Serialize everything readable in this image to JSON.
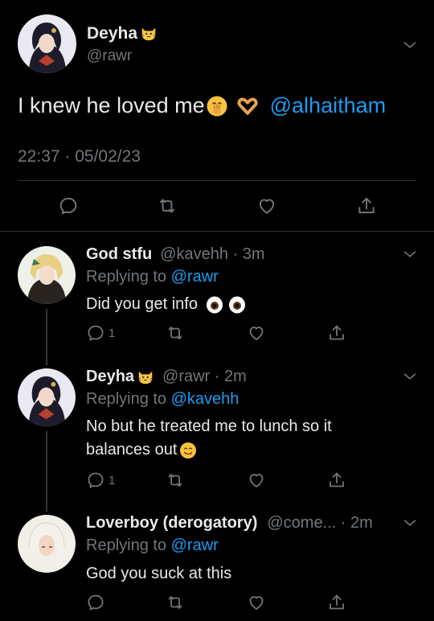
{
  "main": {
    "name": "Deyha",
    "handle": "@rawr",
    "text": "I knew he loved me",
    "mention": "@alhaitham",
    "timestamp": "22:37 · 05/02/23"
  },
  "replies": [
    {
      "name": "God stfu",
      "meta": "@kavehh · 3m",
      "replying_prefix": "Replying to ",
      "replying_to": "@rawr",
      "text": "Did you get info",
      "reply_count": "1"
    },
    {
      "name": "Deyha",
      "meta": "@rawr · 2m",
      "replying_prefix": "Replying to ",
      "replying_to": "@kavehh",
      "text": "No but he treated me to lunch so it balances out",
      "reply_count": "1"
    },
    {
      "name": "Loverboy (derogatory)",
      "meta": "@come... · 2m",
      "replying_prefix": "Replying to ",
      "replying_to": "@rawr",
      "text": "God you suck at this",
      "reply_count": ""
    }
  ],
  "colors": {
    "accent": "#1d9bf0",
    "secondary_text": "#71767b",
    "background": "#000000"
  },
  "icons": [
    "reply-icon",
    "retweet-icon",
    "like-icon",
    "share-icon",
    "chevron-down-icon",
    "cat-emoji-icon",
    "face-hand-emoji-icon",
    "heart-hands-emoji-icon",
    "eyes-emoji-icon",
    "yum-emoji-icon"
  ]
}
